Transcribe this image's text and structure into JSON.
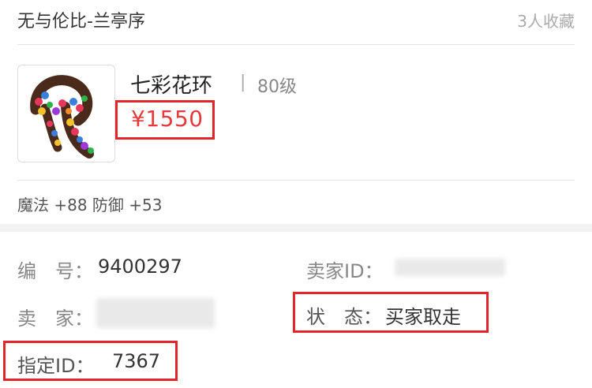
{
  "header": {
    "server_name": "无与伦比-兰亭序",
    "favorites": "3人收藏"
  },
  "item": {
    "name": "七彩花环",
    "separator": "|",
    "level": "80级",
    "price": "¥1550",
    "attributes": "魔法 +88 防御 +53",
    "image_icon": "flower-garland-icon"
  },
  "details": {
    "serial_label": "编　号：",
    "serial_value": "9400297",
    "seller_id_label": "卖家ID：",
    "seller_label": "卖　家：",
    "status_label": "状　态：",
    "status_value": "买家取走",
    "designated_id_label": "指定ID：",
    "designated_id_value": "7367"
  },
  "colors": {
    "price": "#e63a3a",
    "highlight_box": "#e0262a",
    "muted_text": "#888888"
  }
}
